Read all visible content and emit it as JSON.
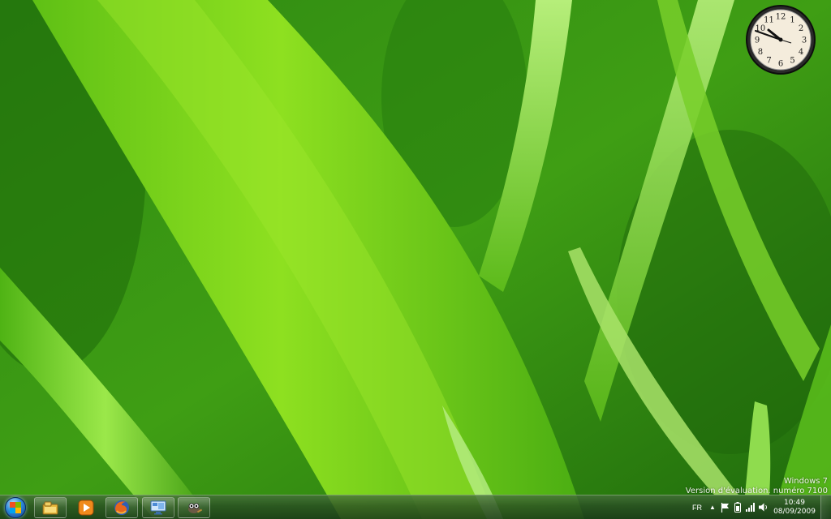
{
  "desktop": {
    "wallpaper_icon": "grass-wallpaper",
    "colors": {
      "grass_light": "#7fd11e",
      "grass_mid": "#43a510",
      "grass_dark": "#1b5e0c"
    }
  },
  "clock_gadget": {
    "numerals": [
      "12",
      "1",
      "2",
      "3",
      "4",
      "5",
      "6",
      "7",
      "8",
      "9",
      "10",
      "11"
    ],
    "time_shown": "10:49"
  },
  "watermark": {
    "line1": "Windows 7",
    "line2": "Version d'évaluation. numéro 7100"
  },
  "taskbar": {
    "start_icon": "windows-orb-icon",
    "pinned": [
      {
        "name": "explorer",
        "icon": "folder-icon"
      },
      {
        "name": "media-player",
        "icon": "media-player-icon"
      },
      {
        "name": "firefox",
        "icon": "firefox-icon"
      },
      {
        "name": "remote-desktop",
        "icon": "monitor-icon"
      },
      {
        "name": "gimp",
        "icon": "gimp-icon"
      }
    ],
    "tray": {
      "language": "FR",
      "show_hidden_glyph": "▲",
      "icons": [
        "action-center-flag-icon",
        "battery-icon",
        "network-signal-icon",
        "volume-icon"
      ],
      "time": "10:49",
      "date": "08/09/2009"
    }
  }
}
